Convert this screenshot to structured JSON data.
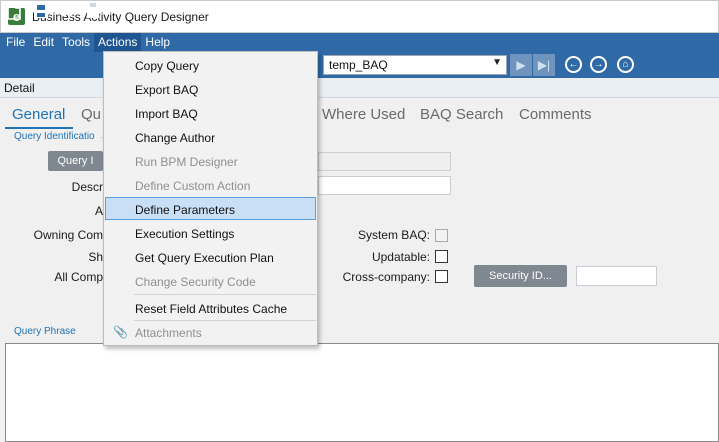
{
  "window": {
    "title": "Business Activity Query Designer",
    "icon_letter": "e"
  },
  "menubar": {
    "items": [
      "File",
      "Edit",
      "Tools",
      "Actions",
      "Help"
    ]
  },
  "toolbar": {
    "query_selector": {
      "value": "temp_BAQ"
    }
  },
  "detail_bar": {
    "label": "Detail"
  },
  "tabs": [
    {
      "label": "General"
    },
    {
      "label": "Qu"
    },
    {
      "label": "Where Used"
    },
    {
      "label": "BAQ Search"
    },
    {
      "label": "Comments"
    }
  ],
  "form": {
    "section_query_identification": "Query Identificatio",
    "query_id_button": "Query I",
    "label_description": "Descr",
    "label_a": "A",
    "label_owning_company": "Owning Com",
    "label_sh": "Sh",
    "label_all_companies": "All Comp",
    "label_system_baq": "System BAQ:",
    "label_updatable": "Updatable:",
    "label_cross_company": "Cross-company:",
    "security_id_button": "Security ID...",
    "section_query_phrase": "Query Phrase"
  },
  "actions_menu": {
    "items": [
      {
        "label": "Copy Query",
        "enabled": true
      },
      {
        "label": "Export BAQ",
        "enabled": true
      },
      {
        "label": "Import BAQ",
        "enabled": true
      },
      {
        "label": "Change Author",
        "enabled": true
      },
      {
        "label": "Run BPM Designer",
        "enabled": false
      },
      {
        "label": "Define Custom Action",
        "enabled": false
      },
      {
        "label": "Define Parameters",
        "enabled": true,
        "highlighted": true
      },
      {
        "label": "Execution Settings",
        "enabled": true
      },
      {
        "label": "Get Query Execution Plan",
        "enabled": true
      },
      {
        "label": "Change Security Code",
        "enabled": false
      },
      {
        "label": "Reset Field Attributes Cache",
        "enabled": true
      },
      {
        "label": "Attachments",
        "enabled": false,
        "icon": "paperclip-icon"
      }
    ]
  },
  "colors": {
    "accent": "#2f6aa7",
    "tab_active": "#1e73b8",
    "menu_highlight": "#c8dff6"
  }
}
